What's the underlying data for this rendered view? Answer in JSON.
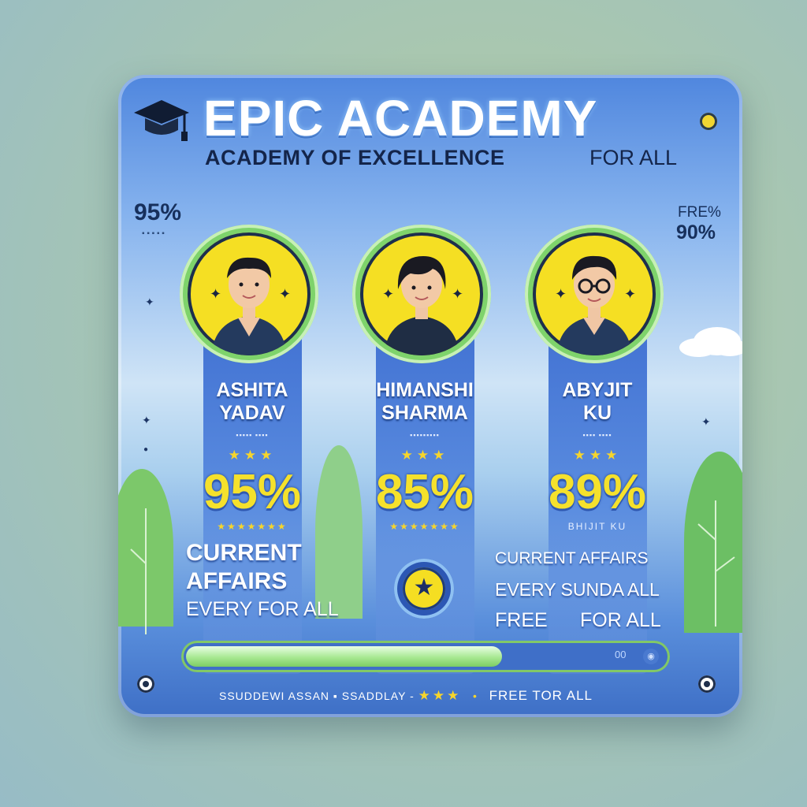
{
  "header": {
    "title": "EPIC ACADEMY",
    "subtitle": "ACADEMY OF EXCELLENCE",
    "subtitle_tag": "FOR ALL"
  },
  "side": {
    "left_value": "95%",
    "left_caption": "▪ ▪ ▪ ▪ ▪",
    "right_label": "FRE%",
    "right_value": "90%"
  },
  "students": [
    {
      "name_line1": "ASHITA",
      "name_line2": "YADAV",
      "name_sub": "▪▪▪▪▪ ▪▪▪▪",
      "stars": "★★★",
      "score": "95%",
      "score_fraction": 0.95,
      "rating": "★★★★★★★"
    },
    {
      "name_line1": "HIMANSHI",
      "name_line2": "SHARMA",
      "name_sub": "▪▪▪▪▪▪▪▪▪",
      "stars": "★★★",
      "score": "85%",
      "score_fraction": 0.85,
      "rating": "★★★★★★★"
    },
    {
      "name_line1": "ABYJIT",
      "name_line2": "KU",
      "name_sub": "▪▪▪▪ ▪▪▪▪",
      "stars": "★★★",
      "score": "89%",
      "score_fraction": 0.89,
      "rating": "BHIJIT KU"
    }
  ],
  "labels": {
    "col1_line1": "CURRENT",
    "col1_line2": "AFFAIRS",
    "col1_line3": "EVERY FOR ALL",
    "col3_line1": "CURRENT AFFAIRS",
    "col3_line2": "EVERY SUNDA ALL",
    "col3_free": "FREE",
    "col3_for_all": "FOR ALL"
  },
  "progress": {
    "fraction": 0.66,
    "text": "00"
  },
  "footer": {
    "left": "SSUDDEWI ASSAN ▪  SSADDLAY -",
    "stars": "★★★",
    "bullet": "•",
    "right": "FREE TOR ALL"
  },
  "icons": {
    "hat": "graduation-cap-icon",
    "star_badge": "star-icon",
    "accent": "#f5e12c",
    "green": "#7ed36b",
    "blue": "#3f6fd1"
  }
}
